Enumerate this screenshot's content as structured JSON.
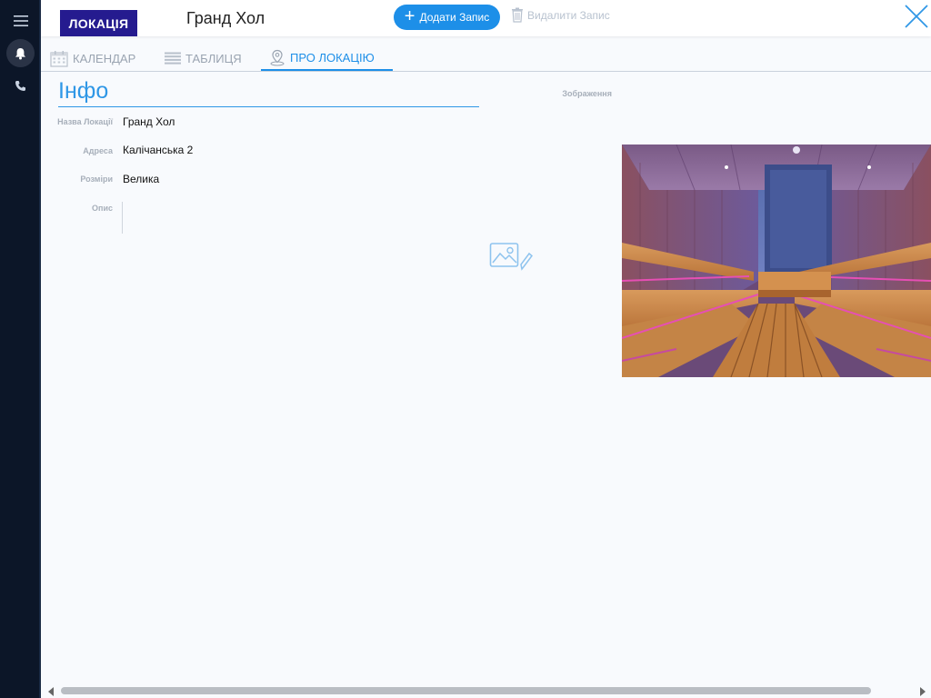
{
  "header": {
    "badge": "ЛОКАЦІЯ",
    "record_title": "Гранд Хол",
    "add_label": "Додати Запис",
    "delete_label": "Видалити Запис"
  },
  "tabs": [
    {
      "label": "КАЛЕНДАР",
      "icon": "calendar-icon"
    },
    {
      "label": "ТАБЛИЦЯ",
      "icon": "table-icon"
    },
    {
      "label": "ПРО ЛОКАЦІЮ",
      "icon": "location-pin-icon",
      "active": true
    }
  ],
  "info": {
    "title": "Інфо",
    "fields": [
      {
        "label": "Назва Локації",
        "value": "Гранд Хол"
      },
      {
        "label": "Адреса",
        "value": "Калічанська 2"
      },
      {
        "label": "Розміри",
        "value": "Велика"
      },
      {
        "label": "Опис",
        "value": ""
      }
    ]
  },
  "image": {
    "label": "Зображення"
  },
  "colors": {
    "accent": "#1d8fe8",
    "badge": "#251b8f",
    "rail": "#0c1628"
  }
}
